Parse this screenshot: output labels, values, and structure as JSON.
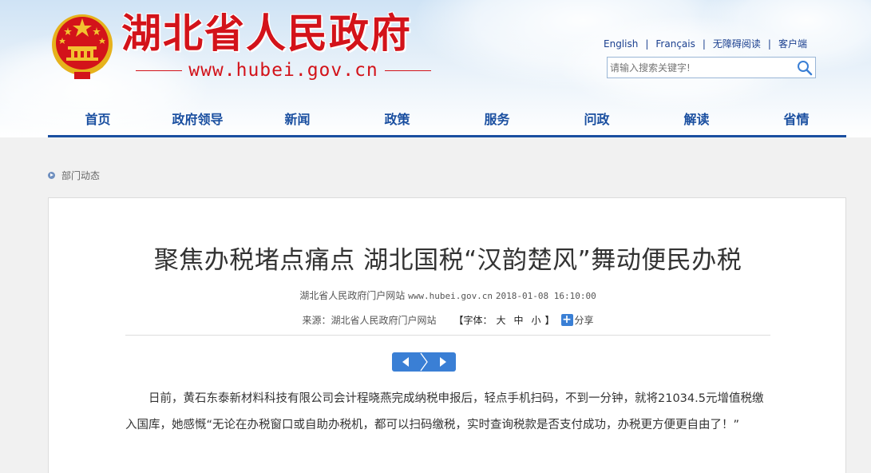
{
  "header": {
    "site_title": "湖北省人民政府",
    "domain": "www.hubei.gov.cn",
    "top_links": [
      "English",
      "Français",
      "无障碍阅读",
      "客户端"
    ],
    "search_placeholder": "请输入搜索关键字!",
    "brand_color": "#d3131a",
    "nav_color": "#1a4fa0"
  },
  "nav": {
    "items": [
      "首页",
      "政府领导",
      "新闻",
      "政策",
      "服务",
      "问政",
      "解读",
      "省情"
    ]
  },
  "breadcrumb": {
    "label": "部门动态"
  },
  "article": {
    "title": "聚焦办税堵点痛点 湖北国税“汉韵楚风”舞动便民办税",
    "publisher": "湖北省人民政府门户网站",
    "publisher_url": "www.hubei.gov.cn",
    "datetime": "2018-01-08 16:10:00",
    "source": "来源：湖北省人民政府门户网站",
    "font_label_open": "【字体：",
    "font_sizes": [
      "大",
      "中",
      "小"
    ],
    "font_label_close": "】",
    "share_label": "分享",
    "paragraph": "日前，黄石东泰新材料科技有限公司会计程晓燕完成纳税申报后，轻点手机扫码，不到一分钟，就将21034.5元增值税缴入国库，她感慨“无论在办税窗口或自助办税机，都可以扫码缴税，实时查询税款是否支付成功，办税更方便更自由了！”"
  }
}
